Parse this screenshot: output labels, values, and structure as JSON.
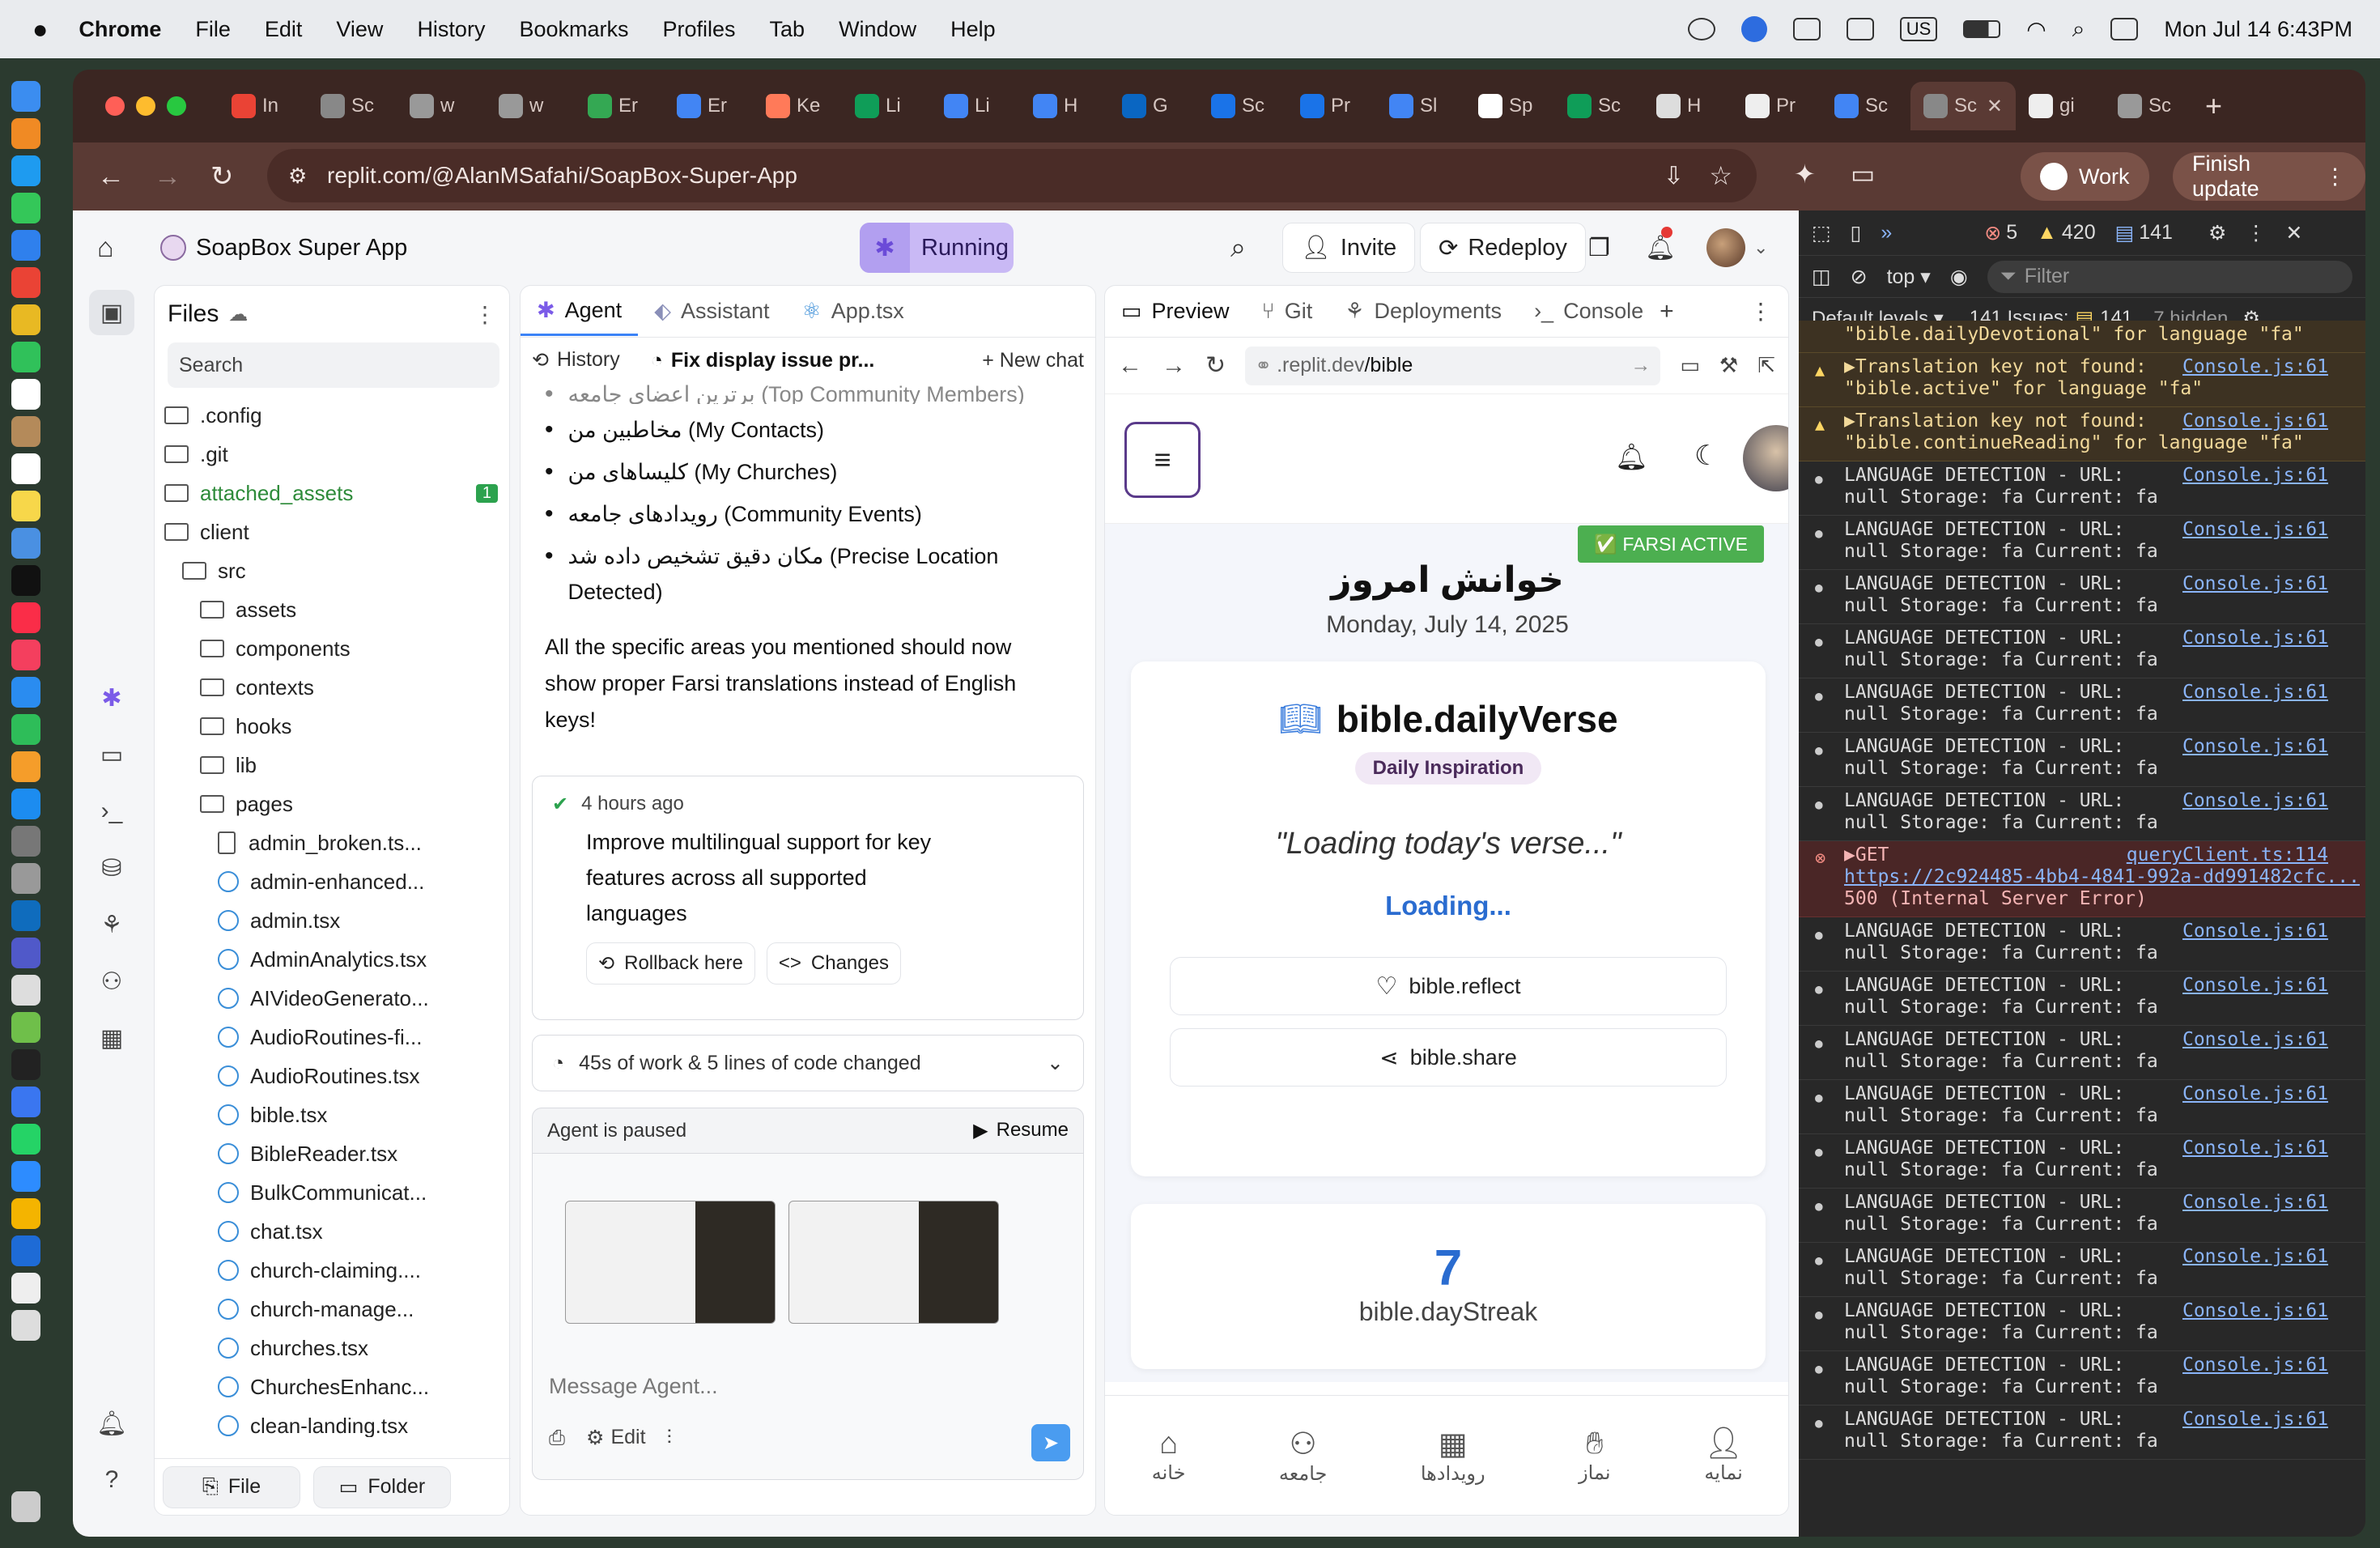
{
  "menubar": {
    "app": "Chrome",
    "items": [
      "File",
      "Edit",
      "View",
      "History",
      "Bookmarks",
      "Profiles",
      "Tab",
      "Window",
      "Help"
    ],
    "input_source": "US",
    "clock": "Mon Jul 14  6:43PM"
  },
  "tabs": [
    {
      "label": "In",
      "color": "#ea4335"
    },
    {
      "label": "Sc",
      "color": "#888"
    },
    {
      "label": "w",
      "color": "#999"
    },
    {
      "label": "w",
      "color": "#999"
    },
    {
      "label": "Er",
      "color": "#34a853"
    },
    {
      "label": "Er",
      "color": "#4285f4"
    },
    {
      "label": "Ke",
      "color": "#ff7a59"
    },
    {
      "label": "Li",
      "color": "#0f9d58"
    },
    {
      "label": "Li",
      "color": "#4285f4"
    },
    {
      "label": "H",
      "color": "#4285f4"
    },
    {
      "label": "G",
      "color": "#0a66c2"
    },
    {
      "label": "Sc",
      "color": "#1a73e8"
    },
    {
      "label": "Pr",
      "color": "#1a73e8"
    },
    {
      "label": "Sl",
      "color": "#4285f4"
    },
    {
      "label": "Sp",
      "color": "#fff"
    },
    {
      "label": "Sc",
      "color": "#0f9d58"
    },
    {
      "label": "H",
      "color": "#ddd"
    },
    {
      "label": "Pr",
      "color": "#eee"
    },
    {
      "label": "Sc",
      "color": "#4285f4"
    },
    {
      "label": "Sc",
      "color": "#888",
      "active": true
    },
    {
      "label": "gi",
      "color": "#eee"
    },
    {
      "label": "Sc",
      "color": "#999"
    }
  ],
  "address": {
    "url": "replit.com/@AlanMSafahi/SoapBox-Super-App",
    "profile": "Work",
    "update": "Finish update"
  },
  "replit": {
    "project": "SoapBox Super App",
    "status": "Running",
    "invite": "Invite",
    "redeploy": "Redeploy"
  },
  "files": {
    "title": "Files",
    "search_placeholder": "Search",
    "badge": "1",
    "buttons": {
      "file": "File",
      "folder": "Folder"
    },
    "tree": [
      {
        "name": ".config",
        "type": "folder",
        "depth": 0
      },
      {
        "name": ".git",
        "type": "folder",
        "depth": 0
      },
      {
        "name": "attached_assets",
        "type": "folder",
        "depth": 0,
        "green": true
      },
      {
        "name": "client",
        "type": "folder",
        "depth": 0
      },
      {
        "name": "src",
        "type": "folder",
        "depth": 1
      },
      {
        "name": "assets",
        "type": "folder",
        "depth": 2
      },
      {
        "name": "components",
        "type": "folder",
        "depth": 2
      },
      {
        "name": "contexts",
        "type": "folder",
        "depth": 2
      },
      {
        "name": "hooks",
        "type": "folder",
        "depth": 2
      },
      {
        "name": "lib",
        "type": "folder",
        "depth": 2
      },
      {
        "name": "pages",
        "type": "folder",
        "depth": 2
      },
      {
        "name": "admin_broken.ts...",
        "type": "file",
        "depth": 3
      },
      {
        "name": "admin-enhanced...",
        "type": "react",
        "depth": 3
      },
      {
        "name": "admin.tsx",
        "type": "react",
        "depth": 3
      },
      {
        "name": "AdminAnalytics.tsx",
        "type": "react",
        "depth": 3
      },
      {
        "name": "AIVideoGenerato...",
        "type": "react",
        "depth": 3
      },
      {
        "name": "AudioRoutines-fi...",
        "type": "react",
        "depth": 3
      },
      {
        "name": "AudioRoutines.tsx",
        "type": "react",
        "depth": 3
      },
      {
        "name": "bible.tsx",
        "type": "react",
        "depth": 3
      },
      {
        "name": "BibleReader.tsx",
        "type": "react",
        "depth": 3
      },
      {
        "name": "BulkCommunicat...",
        "type": "react",
        "depth": 3
      },
      {
        "name": "chat.tsx",
        "type": "react",
        "depth": 3
      },
      {
        "name": "church-claiming....",
        "type": "react",
        "depth": 3
      },
      {
        "name": "church-manage...",
        "type": "react",
        "depth": 3
      },
      {
        "name": "churches.tsx",
        "type": "react",
        "depth": 3
      },
      {
        "name": "ChurchesEnhanc...",
        "type": "react",
        "depth": 3
      },
      {
        "name": "clean-landing.tsx",
        "type": "react",
        "depth": 3
      }
    ]
  },
  "agent": {
    "tabs": [
      "Agent",
      "Assistant",
      "App.tsx"
    ],
    "history": "History",
    "thread": "Fix display issue pr...",
    "new_chat": "New chat",
    "bullets": [
      "برترین اعضای جامعه (Top Community Members)",
      "مخاطبین من (My Contacts)",
      "کلیساهای من (My Churches)",
      "رویدادهای جامعه (Community Events)",
      "مکان دقیق تشخیص داده شد (Precise Location Detected)"
    ],
    "summary": "All the specific areas you mentioned should now show proper Farsi translations instead of English keys!",
    "checkpoint": {
      "time": "4 hours ago",
      "text": "Improve multilingual support for key features across all supported languages",
      "rollback": "Rollback here",
      "changes": "Changes"
    },
    "work": "45s of work & 5 lines of code changed",
    "paused": "Agent is paused",
    "resume": "Resume",
    "placeholder": "Message Agent...",
    "edit": "Edit"
  },
  "preview": {
    "tabs": [
      "Preview",
      "Git",
      "Deployments",
      "Console"
    ],
    "url_prefix": ".replit.dev",
    "url_path": "/bible",
    "badge": "✅ FARSI ACTIVE",
    "heading": "خوانش امروز",
    "date": "Monday, July 14, 2025",
    "verse_title": "bible.dailyVerse",
    "tag": "Daily Inspiration",
    "quote": "\"Loading today's verse...\"",
    "loading": "Loading...",
    "reflect": "bible.reflect",
    "share": "bible.share",
    "streak": "7",
    "streak_label": "bible.dayStreak",
    "nav": [
      "خانه",
      "جامعه",
      "رویدادها",
      "نماز",
      "نمایه"
    ]
  },
  "devtools": {
    "errors": "5",
    "warnings": "420",
    "issues_count": "141",
    "context": "top",
    "filter": "Filter",
    "levels": "Default levels",
    "issues": "141 Issues:",
    "issues_n": "141",
    "hidden": "7 hidden",
    "logs": [
      {
        "kind": "warn",
        "l1": "\"bible.dailyDevotional\" for language \"fa\"",
        "l2": "",
        "src": "",
        "partial": true
      },
      {
        "kind": "warn",
        "l1": "▶Translation key not found:",
        "l2": "\"bible.active\" for language \"fa\"",
        "src": "Console.js:61"
      },
      {
        "kind": "warn",
        "l1": "▶Translation key not found:",
        "l2": "\"bible.continueReading\" for language \"fa\"",
        "src": "Console.js:61"
      },
      {
        "kind": "info",
        "l1": "LANGUAGE DETECTION - URL:",
        "l2": "null Storage: fa Current: fa",
        "src": "Console.js:61"
      },
      {
        "kind": "info",
        "l1": "LANGUAGE DETECTION - URL:",
        "l2": "null Storage: fa Current: fa",
        "src": "Console.js:61"
      },
      {
        "kind": "info",
        "l1": "LANGUAGE DETECTION - URL:",
        "l2": "null Storage: fa Current: fa",
        "src": "Console.js:61"
      },
      {
        "kind": "info",
        "l1": "LANGUAGE DETECTION - URL:",
        "l2": "null Storage: fa Current: fa",
        "src": "Console.js:61"
      },
      {
        "kind": "info",
        "l1": "LANGUAGE DETECTION - URL:",
        "l2": "null Storage: fa Current: fa",
        "src": "Console.js:61"
      },
      {
        "kind": "info",
        "l1": "LANGUAGE DETECTION - URL:",
        "l2": "null Storage: fa Current: fa",
        "src": "Console.js:61"
      },
      {
        "kind": "info",
        "l1": "LANGUAGE DETECTION - URL:",
        "l2": "null Storage: fa Current: fa",
        "src": "Console.js:61"
      },
      {
        "kind": "err",
        "l1": "▶GET",
        "l2": "https://2c924485-4bb4-4841-992a-dd991482cfc...",
        "l3": "500 (Internal Server Error)",
        "src": "queryClient.ts:114"
      },
      {
        "kind": "info",
        "l1": "LANGUAGE DETECTION - URL:",
        "l2": "null Storage: fa Current: fa",
        "src": "Console.js:61"
      },
      {
        "kind": "info",
        "l1": "LANGUAGE DETECTION - URL:",
        "l2": "null Storage: fa Current: fa",
        "src": "Console.js:61"
      },
      {
        "kind": "info",
        "l1": "LANGUAGE DETECTION - URL:",
        "l2": "null Storage: fa Current: fa",
        "src": "Console.js:61"
      },
      {
        "kind": "info",
        "l1": "LANGUAGE DETECTION - URL:",
        "l2": "null Storage: fa Current: fa",
        "src": "Console.js:61"
      },
      {
        "kind": "info",
        "l1": "LANGUAGE DETECTION - URL:",
        "l2": "null Storage: fa Current: fa",
        "src": "Console.js:61"
      },
      {
        "kind": "info",
        "l1": "LANGUAGE DETECTION - URL:",
        "l2": "null Storage: fa Current: fa",
        "src": "Console.js:61"
      },
      {
        "kind": "info",
        "l1": "LANGUAGE DETECTION - URL:",
        "l2": "null Storage: fa Current: fa",
        "src": "Console.js:61"
      },
      {
        "kind": "info",
        "l1": "LANGUAGE DETECTION - URL:",
        "l2": "null Storage: fa Current: fa",
        "src": "Console.js:61"
      },
      {
        "kind": "info",
        "l1": "LANGUAGE DETECTION - URL:",
        "l2": "null Storage: fa Current: fa",
        "src": "Console.js:61"
      },
      {
        "kind": "info",
        "l1": "LANGUAGE DETECTION - URL:",
        "l2": "null Storage: fa Current: fa",
        "src": "Console.js:61"
      }
    ]
  }
}
